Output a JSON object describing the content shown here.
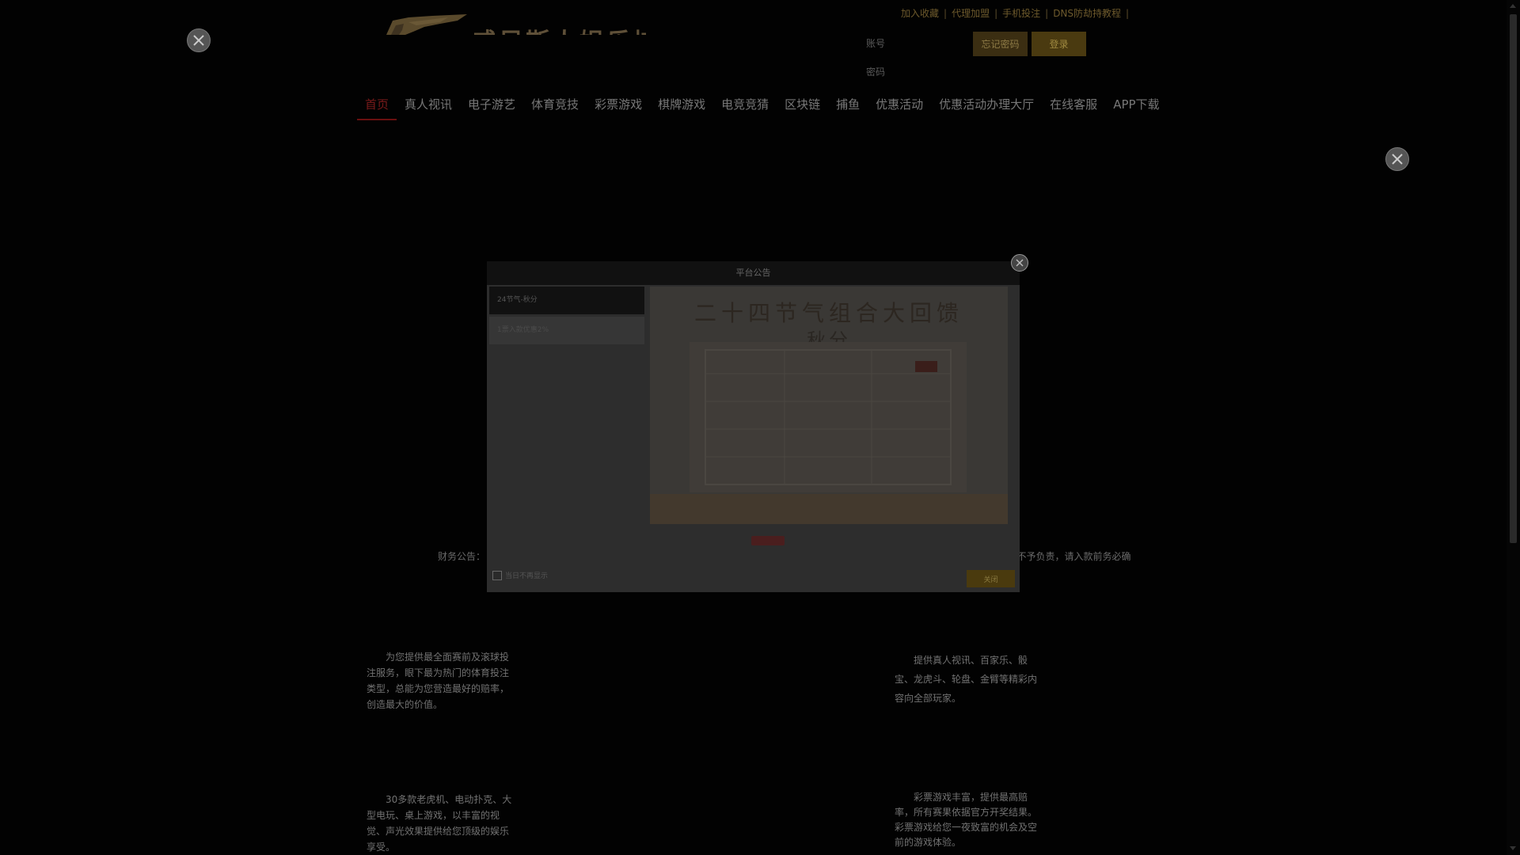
{
  "header": {
    "logo_text": "威尼斯人娱乐城",
    "top_links": [
      "加入收藏",
      "代理加盟",
      "手机投注",
      "DNS防劫持教程"
    ],
    "username_label": "账号",
    "password_label": "密码",
    "forgot_label": "忘记密码",
    "login_label": "登录"
  },
  "nav": {
    "items": [
      "首页",
      "真人视讯",
      "电子游艺",
      "体育竞技",
      "彩票游戏",
      "棋牌游戏",
      "电竞竞猜",
      "区块链",
      "捕鱼",
      "优惠活动",
      "优惠活动办理大厅",
      "在线客服",
      "APP下载"
    ],
    "active_index": 0
  },
  "modal": {
    "title": "平台公告",
    "tabs": [
      "24节气-秋分",
      "1票入款优惠2%"
    ],
    "active_tab": 0,
    "notice_title": "二十四节气组合大回馈",
    "notice_subtitle": "秋分",
    "dont_show_label": "当日不再显示",
    "close_label": "关闭"
  },
  "finance_notice": "财务公告：【上海浦东发展银行 刘畅 】【中国邮政储蓄银行 高小华】已停止收款，已经无法核实查看明细，若存入我司停用收款银行账号概不予负责，请入款前务必确",
  "descriptions": [
    "为您提供最全面赛前及滚球投注服务，眼下最为热门的体育投注类型，总能为您营造最好的赔率，创造最大的价值。",
    "提供真人视讯、百家乐、骰宝、龙虎斗、轮盘、金臂等精彩内容向全部玩家。",
    "30多款老虎机、电动扑克、大型电玩、桌上游戏，以丰富的视觉、声光效果提供给您顶级的娱乐享受。",
    "彩票游戏丰富，提供最高赔率，所有赛果依据官方开奖结果。彩票游戏给您一夜致富的机会及空前的游戏体验。"
  ],
  "icons": {
    "float_close": "close-icon",
    "modal_close": "close-icon"
  },
  "colors": {
    "overlay": "#000000",
    "accent_gold": "#4a3a10",
    "active_nav": "#7a1a1a"
  }
}
